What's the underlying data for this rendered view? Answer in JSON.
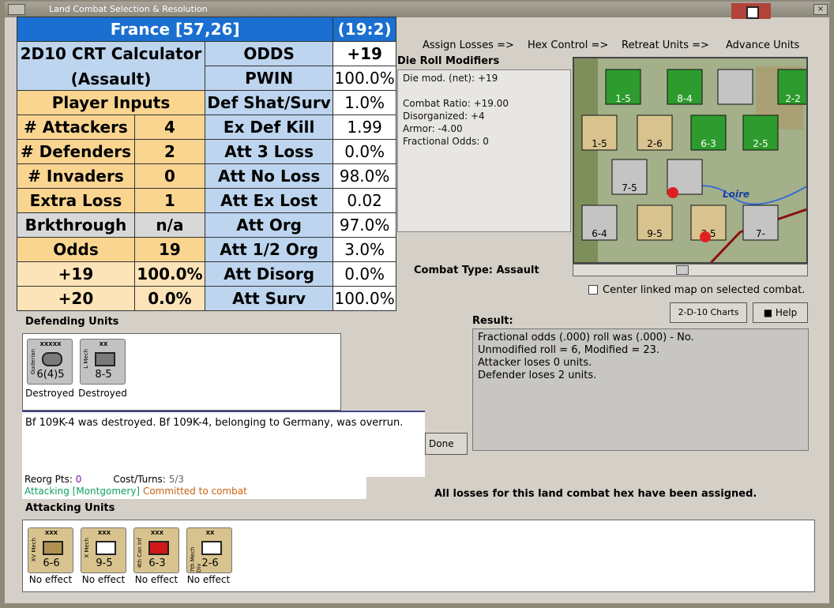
{
  "window": {
    "title": "Land Combat Selection & Resolution",
    "close_label": "×"
  },
  "links": [
    "Assign Losses =>",
    "Hex Control =>",
    "Retreat Units =>",
    "Advance Units"
  ],
  "die_roll": {
    "header": "Die Roll Modifiers",
    "lines": [
      "Die mod. (net): +19",
      "",
      "Combat Ratio: +19.00",
      "Disorganized: +4",
      "Armor: -4.00",
      "Fractional Odds: 0"
    ]
  },
  "map": {
    "label": "Loire",
    "hex_labels": [
      "1-5",
      "8-4",
      "2-2",
      "1-5",
      "2-6",
      "6-3",
      "2-5",
      "7-5",
      "6-4",
      "9-5",
      "3 5",
      "7-"
    ]
  },
  "center_linked": "Center linked map on selected combat.",
  "buttons": {
    "charts": "2-D-10 Charts",
    "help": "Help",
    "done": "Done"
  },
  "combat_type": "Combat Type:  Assault",
  "result": {
    "label": "Result:",
    "lines": [
      "Fractional odds (.000) roll was (.000)  - No.",
      "Unmodified roll = 6, Modified = 23.",
      "Attacker loses 0 units.",
      "Defender loses 2 units."
    ]
  },
  "crt": {
    "header": {
      "place": "France [57,26]",
      "coord": "(19:2)"
    },
    "calc_title1": "2D10 CRT Calculator",
    "calc_title2": "(Assault)",
    "player_inputs": "Player Inputs",
    "left_rows": [
      {
        "label": "# Attackers",
        "value": "4"
      },
      {
        "label": "# Defenders",
        "value": "2"
      },
      {
        "label": "# Invaders",
        "value": "0"
      },
      {
        "label": "Extra Loss",
        "value": "1"
      },
      {
        "label": "Brkthrough",
        "value": "n/a"
      },
      {
        "label": "Odds",
        "value": "19"
      },
      {
        "label": "+19",
        "value": "100.0%"
      },
      {
        "label": "+20",
        "value": "0.0%"
      }
    ],
    "right_rows": [
      {
        "label": "ODDS",
        "value": "+19"
      },
      {
        "label": "PWIN",
        "value": "100.0%"
      },
      {
        "label": "Def Shat/Surv",
        "value": "1.0%"
      },
      {
        "label": "Ex Def Kill",
        "value": "1.99"
      },
      {
        "label": "Att 3 Loss",
        "value": "0.0%"
      },
      {
        "label": "Att No Loss",
        "value": "98.0%"
      },
      {
        "label": "Att Ex Lost",
        "value": "0.02"
      },
      {
        "label": "Att Org",
        "value": "97.0%"
      },
      {
        "label": "Att 1/2 Org",
        "value": "3.0%"
      },
      {
        "label": "Att Disorg",
        "value": "0.0%"
      },
      {
        "label": "Att Surv",
        "value": "100.0%"
      }
    ]
  },
  "defending": {
    "label": "Defending Units",
    "units": [
      {
        "top": "XXXXX",
        "side": "Guderian",
        "strength": "6(4)5",
        "status": "Destroyed"
      },
      {
        "top": "XX",
        "side": "L Mech",
        "strength": "8-5",
        "status": "Destroyed"
      }
    ]
  },
  "message": "Bf 109K-4 was destroyed.  Bf 109K-4, belonging to Germany, was overrun.",
  "stats": {
    "reorg_label": "Reorg Pts:",
    "reorg_value": "0",
    "cost_label": "Cost/Turns:",
    "cost_value": "5/3",
    "attacking": "Attacking [Montgomery]",
    "committed": "Committed to combat"
  },
  "losses_message": "All losses for this land combat hex have been assigned.",
  "attacking": {
    "label": "Attacking Units",
    "units": [
      {
        "top": "XXX",
        "side": "XV Mech",
        "strength": "6-6",
        "status": "No effect"
      },
      {
        "top": "XXX",
        "side": "X Mech",
        "strength": "9-5",
        "status": "No effect"
      },
      {
        "top": "XXX",
        "side": "4th Can Inf",
        "strength": "6-3",
        "status": "No effect"
      },
      {
        "top": "XX",
        "side": "7th Mech Div",
        "strength": "2-6",
        "status": "No effect"
      }
    ]
  },
  "colors": {
    "calc_blue": "#1a6fd0",
    "light_blue": "#bdd5ee",
    "orange": "#fad590",
    "cream": "#fde4b8"
  }
}
